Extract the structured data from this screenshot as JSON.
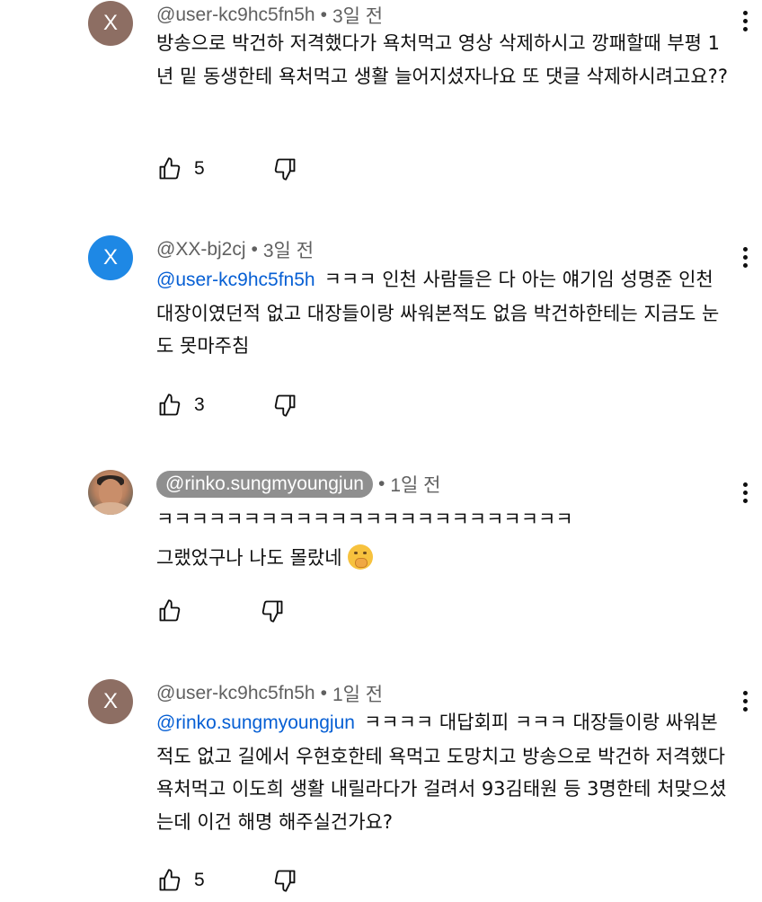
{
  "comments": [
    {
      "avatar_letter": "X",
      "avatar_color": "#8d6e63",
      "handle": "@user-kc9hc5fn5h",
      "time": "3일 전",
      "mention": "",
      "text": "방송으로 박건하 저격했다가 욕처먹고 영상 삭제하시고 깡패할때 부평 1년 밑 동생한테 욕처먹고 생활 늘어지셨자나요 또 댓글 삭제하시려고요??",
      "likes": "5"
    },
    {
      "avatar_letter": "X",
      "avatar_color": "#1e88e5",
      "handle": "@XX-bj2cj",
      "time": "3일 전",
      "mention": "@user-kc9hc5fn5h",
      "text": "ㅋㅋㅋ 인천 사람들은 다 아는 얘기임 성명준 인천 대장이였던적 없고 대장들이랑 싸워본적도 없음 박건하한테는 지금도 눈도 못마주침",
      "likes": "3"
    },
    {
      "avatar_letter": "",
      "avatar_color": "#b9805e",
      "handle": "@rinko.sungmyoungjun",
      "time": "1일 전",
      "mention": "",
      "text_line1": "ㅋㅋㅋㅋㅋㅋㅋㅋㅋㅋㅋㅋㅋㅋㅋㅋㅋㅋㅋㅋㅋㅋㅋㅋ",
      "text_line2": "그랬었구나 나도 몰랐네",
      "emoji": "hand-over-mouth-emoji",
      "likes": ""
    },
    {
      "avatar_letter": "X",
      "avatar_color": "#8d6e63",
      "handle": "@user-kc9hc5fn5h",
      "time": "1일 전",
      "mention": "@rinko.sungmyoungjun",
      "text": "ㅋㅋㅋㅋ 대답회피 ㅋㅋㅋ 대장들이랑 싸워본적도 없고 길에서 우현호한테 욕먹고 도망치고 방송으로 박건하 저격했다 욕처먹고 이도희 생활 내릴라다가 걸려서 93김태원 등 3명한테 처맞으셨는데 이건 해명 해주실건가요?",
      "likes": "5"
    }
  ],
  "separator": "•",
  "icons": {
    "like": "thumbs-up-icon",
    "dislike": "thumbs-down-icon",
    "more": "more-vertical-icon"
  },
  "colors": {
    "mention": "#065fd4",
    "meta": "#606060",
    "handle_pill": "#8f8f8f"
  }
}
